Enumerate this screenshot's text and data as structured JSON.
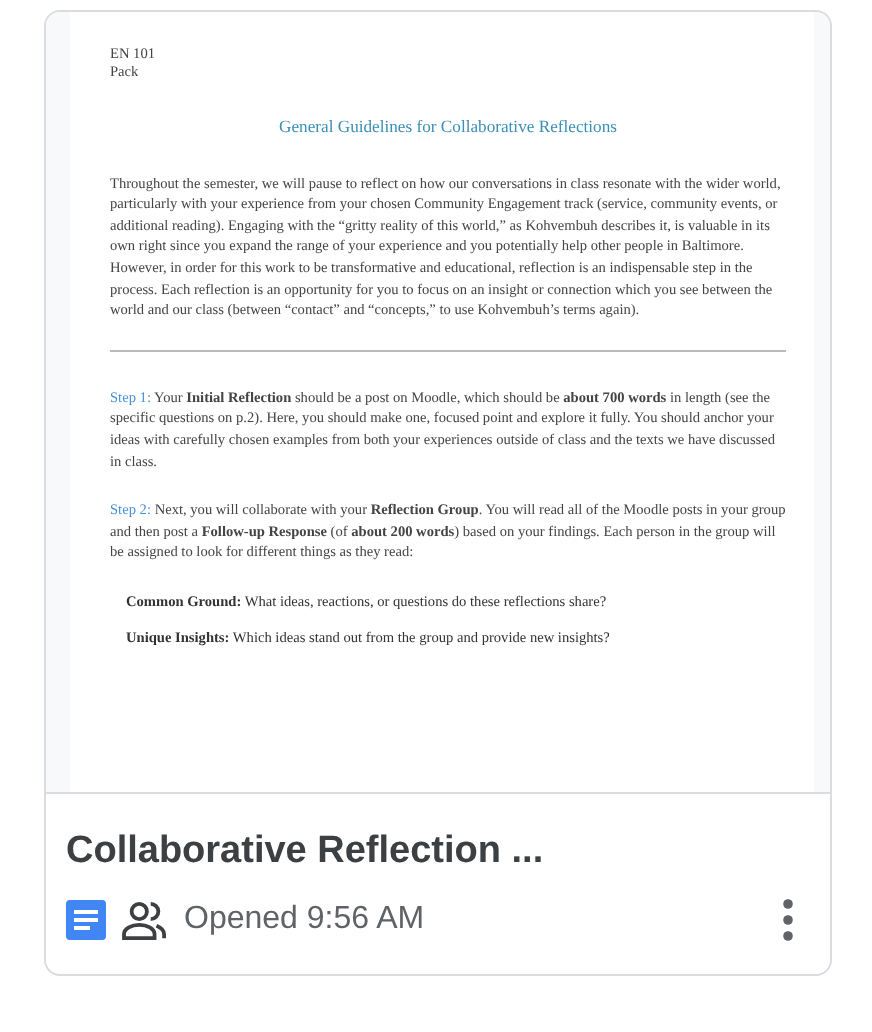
{
  "document": {
    "header": [
      "EN 101",
      "Pack"
    ],
    "title": "General Guidelines for Collaborative Reflections",
    "intro": "Throughout the semester, we will pause to reflect on how our conversations in class resonate with the wider world, particularly with your experience from your chosen Community Engagement track (service, community events, or additional reading). Engaging with the “gritty reality of this world,” as Kohvembuh describes it, is valuable in its own right since you expand the range of your experience and you potentially help other people in Baltimore. However, in order for this work to be transformative and educational, reflection is an indispensable step in the process. Each reflection is an opportunity for you to focus on an insight or connection which you see between the world and our class (between “contact” and “concepts,” to use Kohvembuh’s terms again).",
    "steps": [
      {
        "label": "Step 1:",
        "text": "Your **Initial Reflection** should be a post on Moodle, which should be **about 700 words** in length (see the specific questions on p.2). Here, you should make one, focused point and explore it fully. You should anchor your ideas with carefully chosen examples from both your experiences outside of class and the texts we have discussed in class."
      },
      {
        "label": "Step 2:",
        "text": "Next, you will collaborate with your **Reflection Group**. You will read all of the Moodle posts in your group and then post a **Follow-up Response** (of **about 200 words**) based on your findings. Each person in the group will be assigned to look for different things as they read:"
      }
    ],
    "points": [
      "**Common Ground:** What ideas, reactions, or questions do these reflections share?",
      "**Unique Insights:** Which ideas stand out from the group and provide new insights?"
    ]
  },
  "file": {
    "name": "Collaborative Reflection ...",
    "shared": true,
    "opened": "Opened 9:56 AM"
  }
}
